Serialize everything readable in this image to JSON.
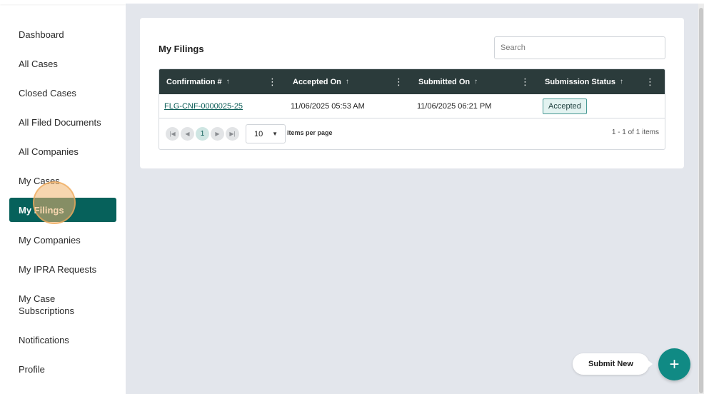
{
  "sidebar": {
    "items": [
      {
        "label": "Dashboard"
      },
      {
        "label": "All Cases"
      },
      {
        "label": "Closed Cases"
      },
      {
        "label": "All Filed Documents"
      },
      {
        "label": "All Companies"
      },
      {
        "label": "My Cases"
      },
      {
        "label": "My Filings"
      },
      {
        "label": "My Companies"
      },
      {
        "label": "My IPRA Requests"
      },
      {
        "label": "My Case Subscriptions"
      },
      {
        "label": "Notifications"
      },
      {
        "label": "Profile"
      }
    ],
    "active_index": 6
  },
  "main": {
    "title": "My Filings",
    "search": {
      "placeholder": "Search",
      "value": ""
    },
    "table": {
      "columns": [
        {
          "label": "Confirmation #"
        },
        {
          "label": "Accepted On"
        },
        {
          "label": "Submitted On"
        },
        {
          "label": "Submission Status"
        }
      ],
      "rows": [
        {
          "confirmation": "FLG-CNF-0000025-25",
          "accepted_on": "11/06/2025 05:53 AM",
          "submitted_on": "11/06/2025 06:21 PM",
          "status": "Accepted"
        }
      ]
    },
    "pager": {
      "current_page": "1",
      "page_size": "10",
      "items_per_page_label": "items per page",
      "count_text": "1 - 1 of 1 items"
    }
  },
  "fab": {
    "label": "Submit New",
    "icon": "plus-icon"
  },
  "colors": {
    "accent": "#06615b",
    "header": "#2b3b3b",
    "fab": "#108a84"
  }
}
